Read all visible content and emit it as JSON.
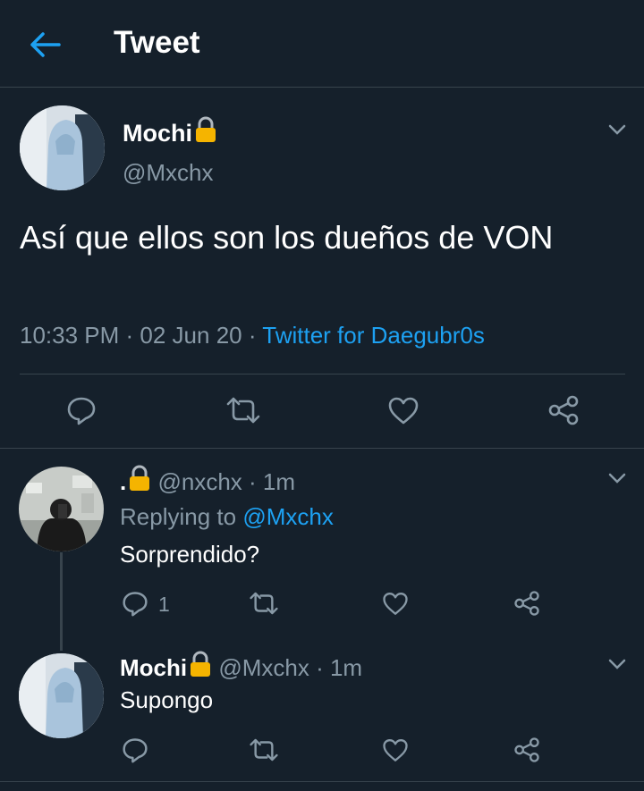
{
  "header": {
    "title": "Tweet"
  },
  "main_tweet": {
    "name": "Mochi",
    "handle": "@Mxchx",
    "text": "Así que ellos son los dueños de VON",
    "time": "10:33 PM",
    "date": "02 Jun 20",
    "source": "Twitter for Daegubr0s"
  },
  "replies": [
    {
      "name": ".",
      "handle": "@nxchx",
      "time": "1m",
      "replying_label": "Replying to",
      "replying_to": "@Mxchx",
      "text": "Sorprendido?",
      "reply_count": "1"
    },
    {
      "name": "Mochi",
      "handle": "@Mxchx",
      "time": "1m",
      "text": "Supongo"
    }
  ],
  "colors": {
    "background": "#15202b",
    "accent": "#1da1f2",
    "muted": "#8899a6",
    "border": "#38444d"
  }
}
